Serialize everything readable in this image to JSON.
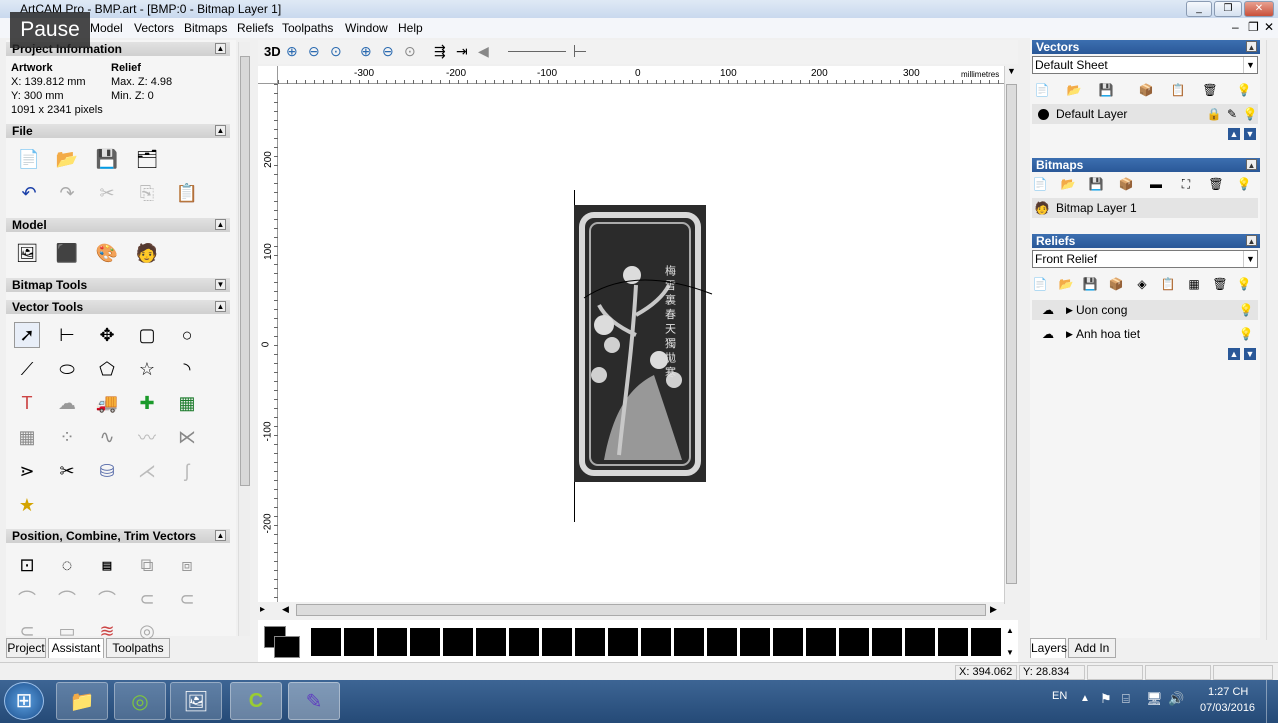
{
  "window": {
    "title": "ArtCAM Pro - BMP.art - [BMP:0 - Bitmap Layer 1]",
    "title_visible": "BMP.art - [BMP:0 - Bitmap Layer 1]"
  },
  "overlay": {
    "pause": "Pause"
  },
  "menu": [
    "Model",
    "Vectors",
    "Bitmaps",
    "Reliefs",
    "Toolpaths",
    "Window",
    "Help"
  ],
  "project_info": {
    "header": "Project Information",
    "artwork_label": "Artwork",
    "relief_label": "Relief",
    "x": "X: 139.812 mm",
    "y": "Y: 300 mm",
    "pixels": "1091 x 2341 pixels",
    "max_z": "Max. Z: 4.98",
    "min_z": "Min. Z: 0"
  },
  "sections": {
    "file": "File",
    "model": "Model",
    "bitmap_tools": "Bitmap Tools",
    "vector_tools": "Vector Tools",
    "position": "Position, Combine, Trim Vectors"
  },
  "left_tabs": [
    "Project",
    "Assistant",
    "Toolpaths"
  ],
  "view_toolbar": {
    "mode_3d": "3D"
  },
  "ruler": {
    "top_ticks": [
      "-300",
      "-200",
      "-100",
      "0",
      "100",
      "200",
      "300"
    ],
    "units": "millimetres",
    "left_ticks": [
      "200",
      "100",
      "0",
      "-100",
      "-200"
    ]
  },
  "vectors": {
    "header": "Vectors",
    "sheet": "Default Sheet",
    "layer": "Default Layer"
  },
  "bitmaps": {
    "header": "Bitmaps",
    "layer": "Bitmap Layer 1"
  },
  "reliefs": {
    "header": "Reliefs",
    "selected": "Front Relief",
    "layers": [
      "Uon cong",
      "Anh hoa tiet"
    ]
  },
  "right_tabs": [
    "Layers",
    "Add In"
  ],
  "status": {
    "x": "X: 394.062",
    "y": "Y: 28.834"
  },
  "tray": {
    "lang": "EN",
    "time": "1:27 CH",
    "date": "07/03/2016"
  },
  "colors": {
    "accent": "#2a5898",
    "relief_bg": "#2b2b2b"
  },
  "carving": {
    "characters": "梅 雪 裏 春 天 獨 拋 寒"
  }
}
